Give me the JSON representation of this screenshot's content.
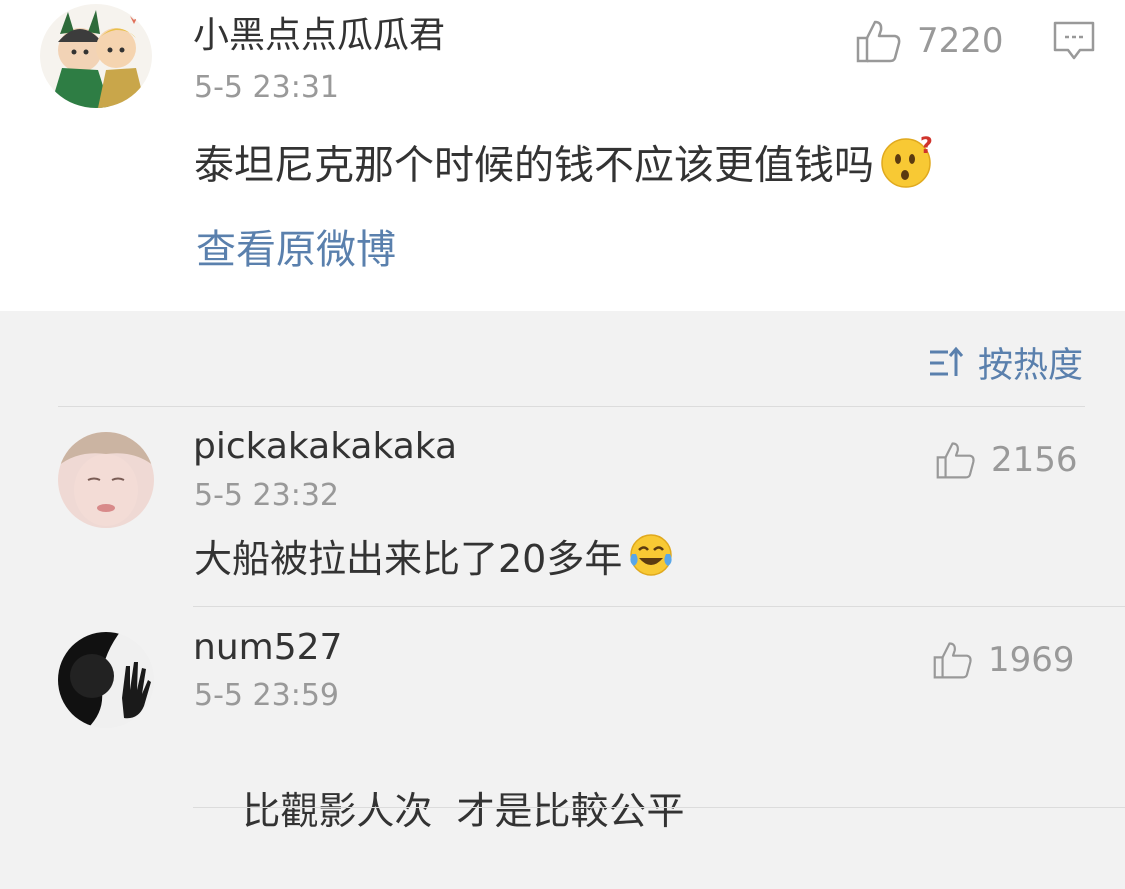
{
  "post": {
    "username": "小黑点点瓜瓜君",
    "time": "5-5 23:31",
    "likes": "7220",
    "content": "泰坦尼克那个时候的钱不应该更值钱吗",
    "content_emoji": "thinking-face-question-emoji",
    "view_original": "查看原微博"
  },
  "sort": {
    "label": "按热度",
    "icon": "sort-icon"
  },
  "comments": [
    {
      "username": "pickakakakaka",
      "time": "5-5 23:32",
      "likes": "2156",
      "content": "大船被拉出来比了20多年",
      "emoji": "laugh-cry-emoji"
    },
    {
      "username": "num527",
      "time": "5-5 23:59",
      "likes": "1969",
      "content": "比觀影人次  才是比較公平"
    }
  ],
  "colors": {
    "link": "#5a80ad",
    "muted": "#999999",
    "text": "#333333",
    "background": "#f2f2f2"
  }
}
